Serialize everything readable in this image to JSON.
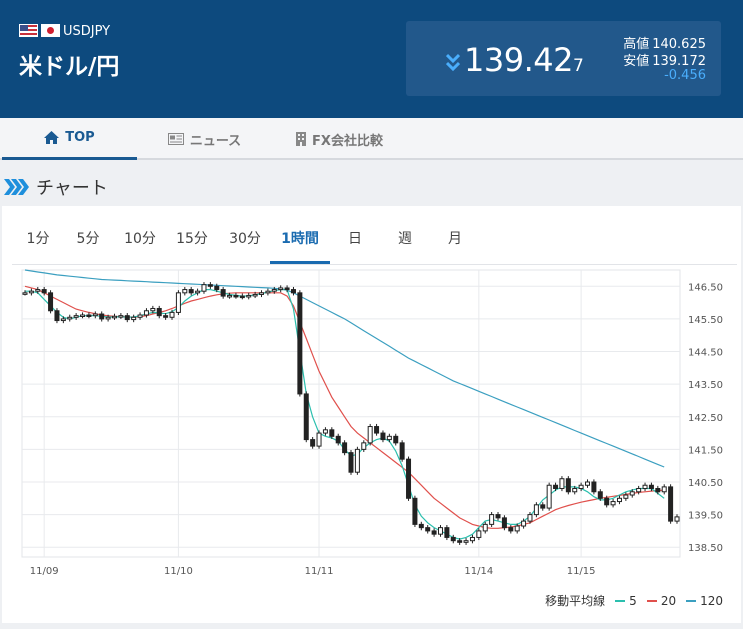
{
  "header": {
    "pair_code": "USDJPY",
    "pair_name": "米ドル/円",
    "rate_main": "139.42",
    "rate_small": "7",
    "high_label": "高値",
    "high_value": "140.625",
    "low_label": "安値",
    "low_value": "139.172",
    "change": "-0.456",
    "direction_icon": "double-chevron-down-icon"
  },
  "nav": {
    "tabs": [
      {
        "label": "TOP",
        "icon": "home-icon",
        "active": true
      },
      {
        "label": "ニュース",
        "icon": "newspaper-icon",
        "active": false
      },
      {
        "label": "FX会社比較",
        "icon": "building-icon",
        "active": false
      }
    ]
  },
  "section": {
    "title": "チャート",
    "icon": "triple-chevron-right-icon"
  },
  "timeframes": [
    {
      "label": "1分",
      "active": false
    },
    {
      "label": "5分",
      "active": false
    },
    {
      "label": "10分",
      "active": false
    },
    {
      "label": "15分",
      "active": false
    },
    {
      "label": "30分",
      "active": false
    },
    {
      "label": "1時間",
      "active": true
    },
    {
      "label": "日",
      "active": false
    },
    {
      "label": "週",
      "active": false
    },
    {
      "label": "月",
      "active": false
    }
  ],
  "legend": {
    "label": "移動平均線",
    "items": [
      {
        "label": "5",
        "color": "#2bbfae"
      },
      {
        "label": "20",
        "color": "#e0504c"
      },
      {
        "label": "120",
        "color": "#3b9fc0"
      }
    ]
  },
  "colors": {
    "header_bg": "#0d4a7e",
    "accent": "#1a6bb0",
    "change": "#4aaefc"
  },
  "chart_data": {
    "type": "candlestick",
    "interval": "1時間",
    "ylim": [
      138.2,
      147.0
    ],
    "y_ticks": [
      "146.50",
      "145.50",
      "144.50",
      "143.50",
      "142.50",
      "141.50",
      "140.50",
      "139.50",
      "138.50"
    ],
    "x_date_ticks": [
      {
        "label": "11/09",
        "index": 3
      },
      {
        "label": "11/10",
        "index": 24
      },
      {
        "label": "11/11",
        "index": 46
      },
      {
        "label": "11/14",
        "index": 71
      },
      {
        "label": "11/15",
        "index": 87
      }
    ],
    "closes": [
      146.3,
      146.35,
      146.4,
      146.3,
      145.75,
      145.45,
      145.5,
      145.55,
      145.6,
      145.62,
      145.6,
      145.65,
      145.5,
      145.55,
      145.58,
      145.6,
      145.48,
      145.55,
      145.62,
      145.75,
      145.82,
      145.6,
      145.55,
      145.7,
      146.3,
      146.4,
      146.3,
      146.35,
      146.55,
      146.5,
      146.4,
      146.2,
      146.22,
      146.2,
      146.18,
      146.22,
      146.25,
      146.3,
      146.35,
      146.4,
      146.45,
      146.4,
      146.3,
      143.2,
      141.8,
      141.6,
      142.0,
      142.1,
      141.9,
      141.7,
      141.4,
      140.8,
      141.5,
      141.7,
      142.2,
      142.0,
      141.8,
      141.9,
      141.7,
      141.2,
      140.0,
      139.2,
      139.1,
      139.0,
      138.9,
      139.1,
      138.8,
      138.7,
      138.65,
      138.7,
      138.8,
      139.0,
      139.2,
      139.5,
      139.4,
      139.1,
      139.0,
      139.15,
      139.3,
      139.5,
      139.8,
      139.7,
      140.4,
      140.3,
      140.6,
      140.2,
      140.3,
      140.4,
      140.5,
      140.2,
      140.0,
      139.8,
      139.9,
      140.0,
      140.1,
      140.2,
      140.3,
      140.4,
      140.3,
      140.2,
      140.35,
      139.3,
      139.43
    ],
    "ma5": [
      146.35,
      146.35,
      146.3,
      146.1,
      145.9,
      145.7,
      145.55,
      145.5,
      145.55,
      145.6,
      145.6,
      145.6,
      145.58,
      145.56,
      145.56,
      145.57,
      145.55,
      145.56,
      145.6,
      145.65,
      145.7,
      145.68,
      145.66,
      145.72,
      145.85,
      146.05,
      146.2,
      146.3,
      146.4,
      146.4,
      146.35,
      146.3,
      146.25,
      146.22,
      146.2,
      146.21,
      146.24,
      146.28,
      146.32,
      146.37,
      146.4,
      146.4,
      145.8,
      144.5,
      143.2,
      142.5,
      142.0,
      141.9,
      141.85,
      141.75,
      141.5,
      141.3,
      141.35,
      141.55,
      141.7,
      141.8,
      141.85,
      141.75,
      141.45,
      141.0,
      140.4,
      139.8,
      139.45,
      139.25,
      139.1,
      139.0,
      138.9,
      138.8,
      138.75,
      138.8,
      138.9,
      139.1,
      139.3,
      139.35,
      139.3,
      139.25,
      139.2,
      139.2,
      139.3,
      139.45,
      139.7,
      139.95,
      140.1,
      140.25,
      140.35,
      140.35,
      140.35,
      140.3,
      140.2,
      140.05,
      139.95,
      139.95,
      140.0,
      140.1,
      140.2,
      140.25,
      140.3,
      140.3,
      140.3,
      140.15,
      140.0
    ],
    "ma20": [
      146.5,
      146.45,
      146.4,
      146.3,
      146.2,
      146.1,
      146.0,
      145.9,
      145.8,
      145.75,
      145.7,
      145.66,
      145.62,
      145.6,
      145.58,
      145.57,
      145.56,
      145.56,
      145.57,
      145.6,
      145.65,
      145.7,
      145.75,
      145.82,
      145.9,
      145.98,
      146.05,
      146.1,
      146.15,
      146.2,
      146.24,
      146.27,
      146.29,
      146.3,
      146.3,
      146.3,
      146.3,
      146.3,
      146.3,
      146.3,
      146.3,
      146.2,
      145.9,
      145.4,
      144.9,
      144.4,
      143.9,
      143.5,
      143.1,
      142.8,
      142.5,
      142.2,
      142.0,
      141.85,
      141.7,
      141.55,
      141.4,
      141.25,
      141.1,
      140.95,
      140.8,
      140.6,
      140.4,
      140.2,
      140.0,
      139.85,
      139.7,
      139.55,
      139.4,
      139.3,
      139.2,
      139.15,
      139.1,
      139.08,
      139.08,
      139.1,
      139.12,
      139.15,
      139.2,
      139.25,
      139.35,
      139.45,
      139.55,
      139.65,
      139.72,
      139.78,
      139.83,
      139.88,
      139.92,
      139.96,
      140.0,
      140.03,
      140.06,
      140.09,
      140.12,
      140.15,
      140.18,
      140.2,
      140.22,
      140.24,
      140.25
    ],
    "ma120": [
      147.0,
      146.97,
      146.94,
      146.91,
      146.88,
      146.85,
      146.83,
      146.81,
      146.79,
      146.77,
      146.75,
      146.73,
      146.71,
      146.7,
      146.69,
      146.68,
      146.67,
      146.66,
      146.65,
      146.64,
      146.63,
      146.62,
      146.61,
      146.6,
      146.59,
      146.58,
      146.57,
      146.56,
      146.55,
      146.54,
      146.53,
      146.52,
      146.51,
      146.5,
      146.49,
      146.48,
      146.47,
      146.46,
      146.45,
      146.44,
      146.42,
      146.38,
      146.3,
      146.2,
      146.1,
      146.0,
      145.9,
      145.8,
      145.7,
      145.6,
      145.5,
      145.38,
      145.26,
      145.14,
      145.02,
      144.9,
      144.78,
      144.66,
      144.54,
      144.42,
      144.3,
      144.2,
      144.1,
      144.0,
      143.9,
      143.8,
      143.7,
      143.6,
      143.52,
      143.44,
      143.36,
      143.28,
      143.2,
      143.12,
      143.04,
      142.96,
      142.88,
      142.8,
      142.72,
      142.64,
      142.56,
      142.48,
      142.4,
      142.32,
      142.24,
      142.16,
      142.08,
      142.0,
      141.92,
      141.84,
      141.76,
      141.68,
      141.6,
      141.52,
      141.44,
      141.36,
      141.28,
      141.2,
      141.12,
      141.04,
      140.96
    ]
  }
}
